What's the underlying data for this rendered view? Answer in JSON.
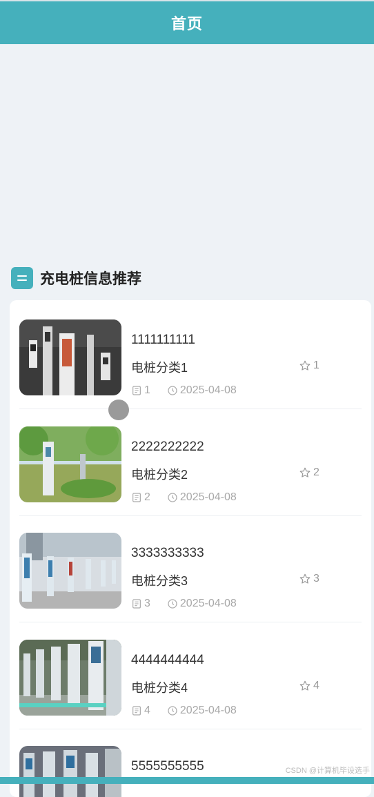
{
  "header": {
    "title": "首页"
  },
  "section": {
    "title": "充电桩信息推荐",
    "icon": "list-icon"
  },
  "items": [
    {
      "name": "1111111111",
      "category": "电桩分类1",
      "favorites": "1",
      "comments": "1",
      "date": "2025-04-08"
    },
    {
      "name": "2222222222",
      "category": "电桩分类2",
      "favorites": "2",
      "comments": "2",
      "date": "2025-04-08"
    },
    {
      "name": "3333333333",
      "category": "电桩分类3",
      "favorites": "3",
      "comments": "3",
      "date": "2025-04-08"
    },
    {
      "name": "4444444444",
      "category": "电桩分类4",
      "favorites": "4",
      "comments": "4",
      "date": "2025-04-08"
    },
    {
      "name": "5555555555"
    }
  ],
  "watermark": "CSDN @计算机毕设选手",
  "colors": {
    "accent": "#45b0bc",
    "background": "#eef2f6",
    "muted": "#a8a8a8"
  }
}
